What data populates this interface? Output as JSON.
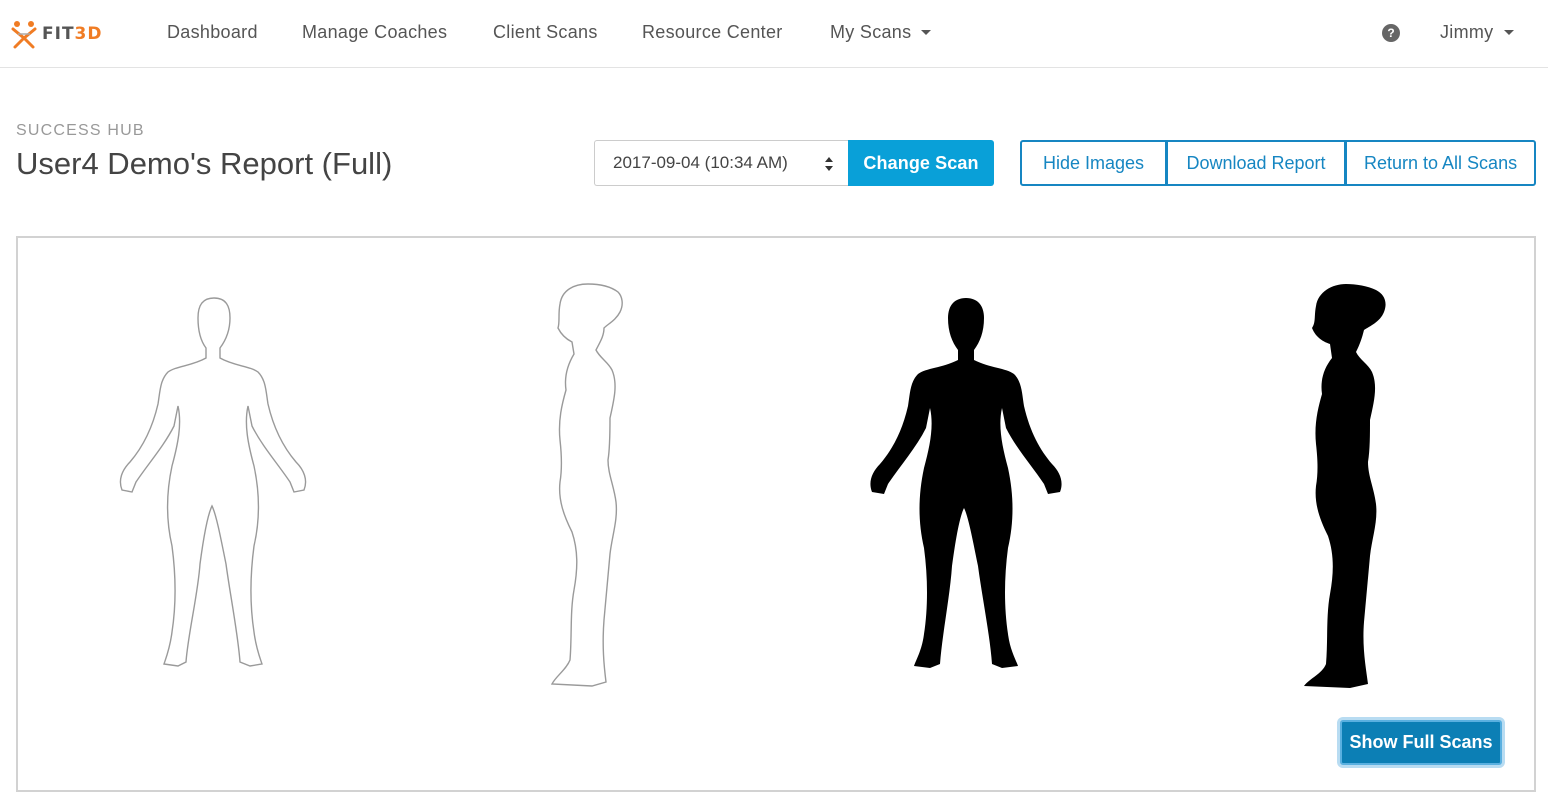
{
  "brand": {
    "name_left": "FIT",
    "name_right": "3D"
  },
  "nav": {
    "items": [
      {
        "label": "Dashboard"
      },
      {
        "label": "Manage Coaches"
      },
      {
        "label": "Client Scans"
      },
      {
        "label": "Resource Center"
      },
      {
        "label": "My Scans"
      }
    ],
    "help_glyph": "?",
    "user_label": "Jimmy"
  },
  "header": {
    "eyebrow": "SUCCESS HUB",
    "title": "User4 Demo's Report (Full)"
  },
  "scan_picker": {
    "selected": "2017-09-04 (10:34 AM)",
    "change_label": "Change Scan"
  },
  "actions": {
    "hide_images": "Hide Images",
    "download_report": "Download Report",
    "return_all": "Return to All Scans"
  },
  "panel": {
    "show_full_label": "Show Full Scans"
  },
  "colors": {
    "accent": "#09a0d8",
    "outline": "#1686c2",
    "brand_orange": "#f07c24"
  },
  "icons": [
    "fit3d-logo-icon",
    "help-icon",
    "caret-down-icon",
    "select-updown-icon"
  ]
}
